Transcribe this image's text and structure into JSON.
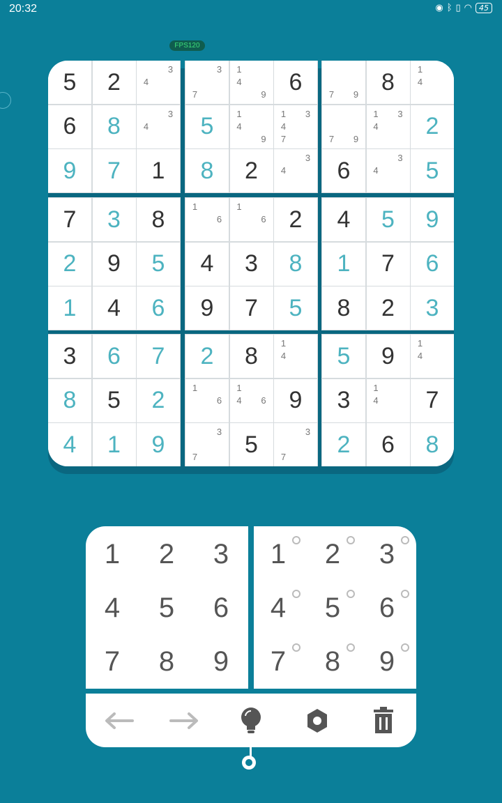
{
  "status_bar": {
    "time": "20:32",
    "battery": "45"
  },
  "fps_label": "FPS120",
  "board": {
    "values": [
      [
        "5",
        "2",
        "",
        "",
        "",
        "6",
        "",
        "8",
        ""
      ],
      [
        "6",
        "8",
        "",
        "5",
        "",
        "",
        "",
        "",
        "2"
      ],
      [
        "9",
        "7",
        "1",
        "8",
        "2",
        "",
        "6",
        "",
        "5"
      ],
      [
        "7",
        "3",
        "8",
        "",
        "",
        "2",
        "4",
        "5",
        "9"
      ],
      [
        "2",
        "9",
        "5",
        "4",
        "3",
        "8",
        "1",
        "7",
        "6"
      ],
      [
        "1",
        "4",
        "6",
        "9",
        "7",
        "5",
        "8",
        "2",
        "3"
      ],
      [
        "3",
        "6",
        "7",
        "2",
        "8",
        "",
        "5",
        "9",
        ""
      ],
      [
        "8",
        "5",
        "2",
        "",
        "",
        "9",
        "3",
        "",
        "7"
      ],
      [
        "4",
        "1",
        "9",
        "",
        "5",
        "",
        "2",
        "6",
        "8"
      ]
    ],
    "given": [
      [
        1,
        1,
        0,
        0,
        0,
        1,
        0,
        1,
        0
      ],
      [
        1,
        0,
        0,
        0,
        0,
        0,
        0,
        0,
        0
      ],
      [
        0,
        0,
        1,
        0,
        1,
        0,
        1,
        0,
        0
      ],
      [
        1,
        0,
        1,
        0,
        0,
        1,
        1,
        0,
        0
      ],
      [
        0,
        1,
        0,
        1,
        1,
        0,
        0,
        1,
        0
      ],
      [
        0,
        1,
        0,
        1,
        1,
        0,
        1,
        1,
        0
      ],
      [
        1,
        0,
        0,
        0,
        1,
        0,
        0,
        1,
        0
      ],
      [
        0,
        1,
        0,
        0,
        0,
        1,
        1,
        0,
        1
      ],
      [
        0,
        0,
        0,
        0,
        1,
        0,
        0,
        1,
        0
      ]
    ],
    "pencil_marks": [
      [
        [],
        [],
        [
          "3",
          "4"
        ],
        [
          "3",
          "7"
        ],
        [
          "1",
          "4",
          "9"
        ],
        [],
        [
          "7",
          "9"
        ],
        [],
        [
          "1",
          "4"
        ]
      ],
      [
        [],
        [],
        [
          "3",
          "4"
        ],
        [],
        [
          "1",
          "4",
          "9"
        ],
        [
          "1",
          "3",
          "4",
          "7"
        ],
        [
          "7",
          "9"
        ],
        [
          "1",
          "3",
          "4"
        ],
        []
      ],
      [
        [],
        [],
        [],
        [],
        [],
        [
          "3",
          "4"
        ],
        [],
        [
          "3",
          "4"
        ],
        []
      ],
      [
        [],
        [],
        [],
        [
          "1",
          "6"
        ],
        [
          "1",
          "6"
        ],
        [],
        [],
        [],
        []
      ],
      [
        [],
        [],
        [],
        [],
        [],
        [],
        [],
        [],
        []
      ],
      [
        [],
        [],
        [],
        [],
        [],
        [],
        [],
        [],
        []
      ],
      [
        [],
        [],
        [],
        [],
        [],
        [
          "1",
          "4"
        ],
        [],
        [],
        [
          "1",
          "4"
        ]
      ],
      [
        [],
        [],
        [],
        [
          "1",
          "6"
        ],
        [
          "1",
          "4",
          "6"
        ],
        [],
        [],
        [
          "1",
          "4"
        ],
        []
      ],
      [
        [],
        [],
        [],
        [
          "3",
          "7"
        ],
        [],
        [
          "3",
          "7"
        ],
        [],
        [],
        []
      ]
    ]
  },
  "number_pad": {
    "digits": [
      "1",
      "2",
      "3",
      "4",
      "5",
      "6",
      "7",
      "8",
      "9"
    ],
    "note_digits": [
      "1",
      "2",
      "3",
      "4",
      "5",
      "6",
      "7",
      "8",
      "9"
    ]
  },
  "toolbar": {
    "icons": [
      "undo-arrow-icon",
      "redo-arrow-icon",
      "hint-lightbulb-icon",
      "settings-gear-icon",
      "delete-trash-icon"
    ]
  },
  "colors": {
    "background": "#0b7f99",
    "given_digit": "#333333",
    "user_digit": "#4db3c0",
    "pencil": "#777777"
  }
}
